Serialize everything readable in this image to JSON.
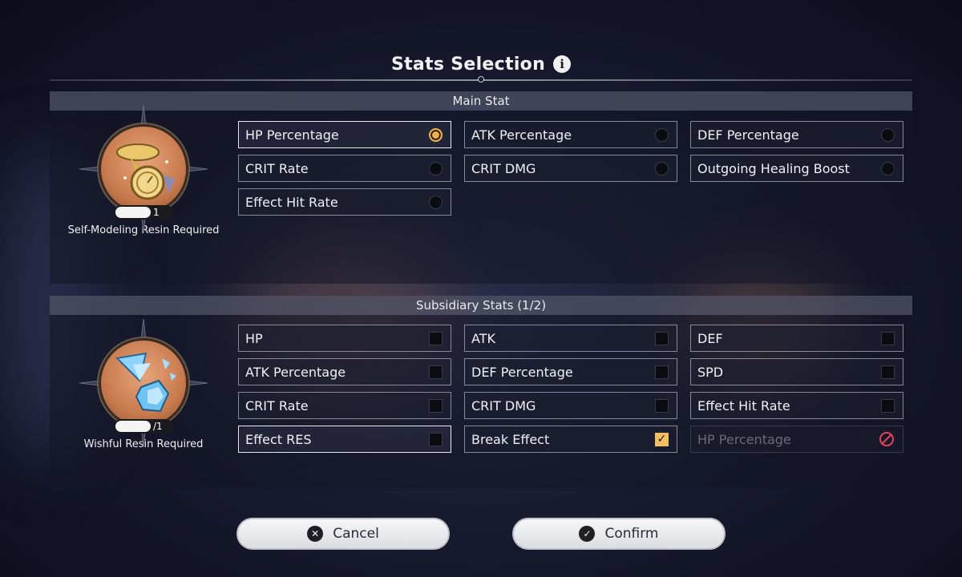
{
  "header": {
    "title": "Stats Selection",
    "info_icon": "info-icon"
  },
  "main_stat": {
    "title": "Main Stat",
    "resin": {
      "count_suffix": "1",
      "label": "Self-Modeling Resin Required"
    },
    "options": [
      {
        "label": "HP Percentage",
        "state": "selected"
      },
      {
        "label": "ATK Percentage",
        "state": "unselected"
      },
      {
        "label": "DEF Percentage",
        "state": "unselected"
      },
      {
        "label": "CRIT Rate",
        "state": "unselected"
      },
      {
        "label": "CRIT DMG",
        "state": "unselected"
      },
      {
        "label": "Outgoing Healing Boost",
        "state": "unselected"
      },
      {
        "label": "Effect Hit Rate",
        "state": "unselected"
      }
    ]
  },
  "subsidiary_stats": {
    "title": "Subsidiary Stats (1/2)",
    "resin": {
      "count_suffix": "/1",
      "label": "Wishful Resin Required"
    },
    "options": [
      {
        "label": "HP",
        "state": "unchecked"
      },
      {
        "label": "ATK",
        "state": "unchecked"
      },
      {
        "label": "DEF",
        "state": "unchecked"
      },
      {
        "label": "ATK Percentage",
        "state": "unchecked"
      },
      {
        "label": "DEF Percentage",
        "state": "unchecked"
      },
      {
        "label": "SPD",
        "state": "unchecked"
      },
      {
        "label": "CRIT Rate",
        "state": "unchecked"
      },
      {
        "label": "CRIT DMG",
        "state": "unchecked"
      },
      {
        "label": "Effect Hit Rate",
        "state": "unchecked"
      },
      {
        "label": "Effect RES",
        "state": "unchecked"
      },
      {
        "label": "Break Effect",
        "state": "checked"
      },
      {
        "label": "HP Percentage",
        "state": "disabled"
      }
    ]
  },
  "buttons": {
    "cancel": {
      "label": "Cancel",
      "icon": "close-icon"
    },
    "confirm": {
      "label": "Confirm",
      "icon": "check-icon"
    }
  },
  "colors": {
    "accent": "#f0b24a",
    "check_fill": "#f2c063",
    "ban_icon": "#e0455a"
  }
}
